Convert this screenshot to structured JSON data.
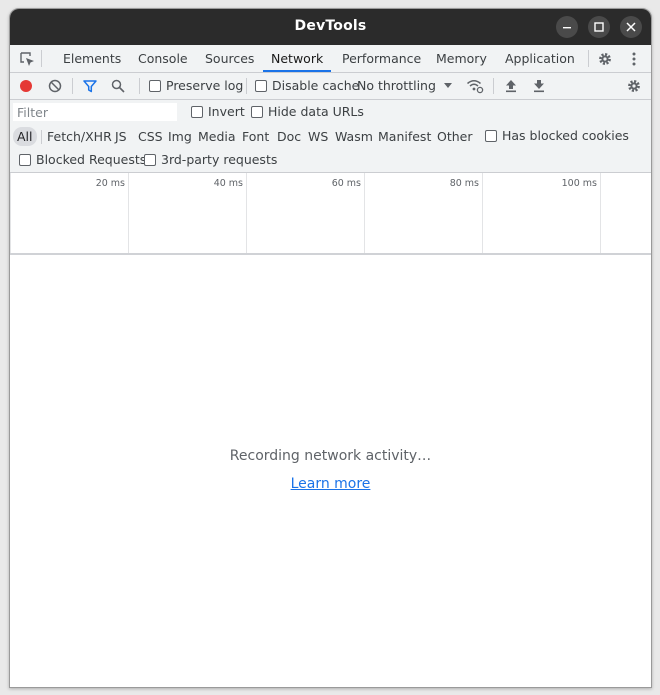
{
  "window": {
    "title": "DevTools",
    "controls": {
      "minimize": "minimize-icon",
      "maximize": "maximize-icon",
      "close": "close-icon"
    }
  },
  "tabs": [
    {
      "label": "Elements",
      "active": false
    },
    {
      "label": "Console",
      "active": false
    },
    {
      "label": "Sources",
      "active": false
    },
    {
      "label": "Network",
      "active": true
    },
    {
      "label": "Performance",
      "active": false
    },
    {
      "label": "Memory",
      "active": false
    },
    {
      "label": "Application",
      "active": false
    }
  ],
  "toolbar": {
    "preserve_log": "Preserve log",
    "disable_cache": "Disable cache",
    "throttling": "No throttling"
  },
  "filter": {
    "placeholder": "Filter",
    "invert": "Invert",
    "hide_data_urls": "Hide data URLs",
    "types": [
      "All",
      "Fetch/XHR",
      "JS",
      "CSS",
      "Img",
      "Media",
      "Font",
      "Doc",
      "WS",
      "Wasm",
      "Manifest",
      "Other"
    ],
    "has_blocked_cookies": "Has blocked cookies",
    "blocked_requests": "Blocked Requests",
    "third_party": "3rd-party requests"
  },
  "timeline": {
    "ticks": [
      "20 ms",
      "40 ms",
      "60 ms",
      "80 ms",
      "100 ms"
    ]
  },
  "empty_state": {
    "message": "Recording network activity…",
    "link": "Learn more"
  },
  "colors": {
    "record": "#e53935",
    "accent": "#1a73e8",
    "titlebar": "#2b2b2b"
  }
}
